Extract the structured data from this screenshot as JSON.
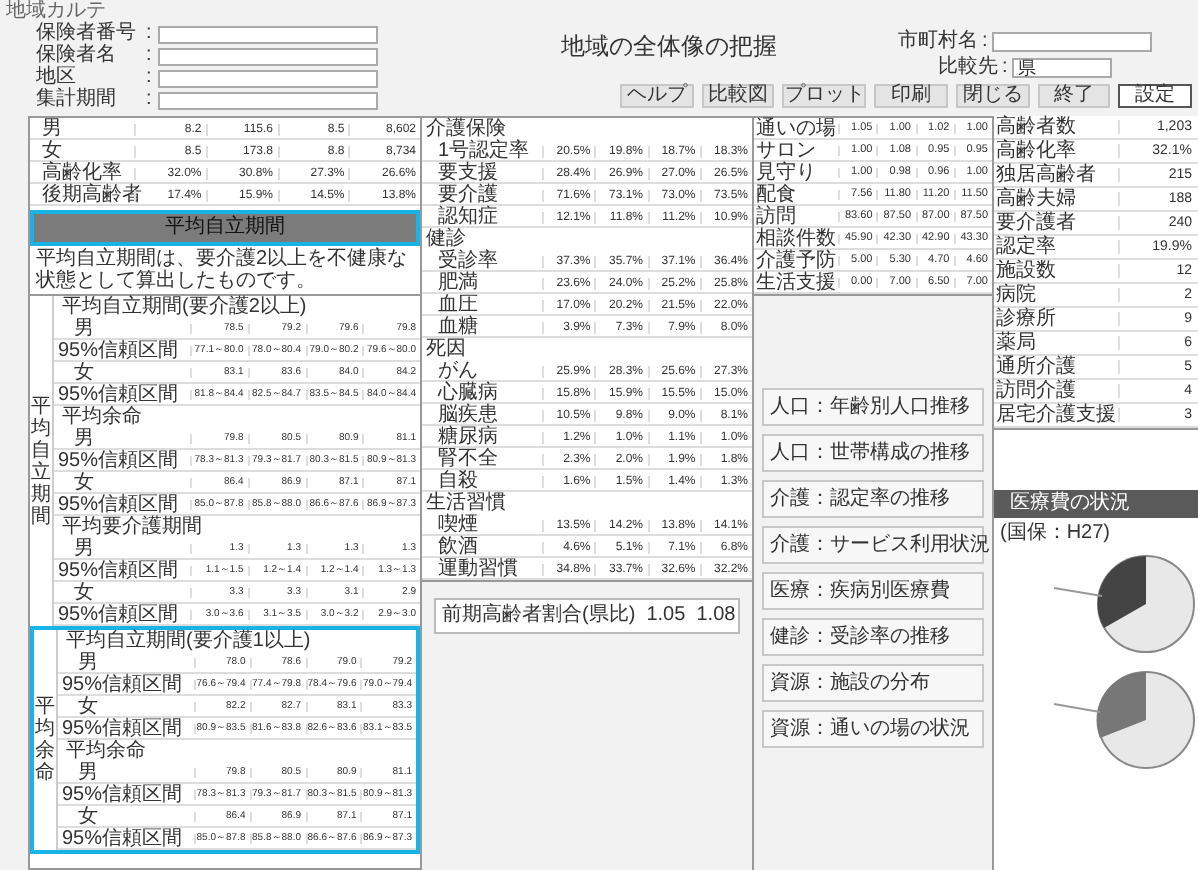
{
  "app_title": "地域カルテ",
  "filters": [
    {
      "label": "保険者番号",
      "separator": ":"
    },
    {
      "label": "保険者名",
      "separator": ":"
    },
    {
      "label": "地区",
      "separator": ":"
    },
    {
      "label": "集計期間",
      "separator": ":"
    }
  ],
  "title": "地域の全体像の把握",
  "compare": [
    {
      "label": "市町村名",
      "separator": ":"
    },
    {
      "label": "比較先",
      "separator": ":",
      "value": "県"
    }
  ],
  "buttons": [
    "ヘルプ",
    "比較図",
    "プロット",
    "印刷",
    "閉じる",
    "終了",
    "設定"
  ],
  "population_table": {
    "rows": [
      {
        "label": "男",
        "values": [
          "8.2",
          "115.6",
          "8.5",
          "8,602"
        ]
      },
      {
        "label": "女",
        "values": [
          "8.5",
          "173.8",
          "8.8",
          "8,734"
        ]
      },
      {
        "label": "高齢化率",
        "values": [
          "32.0%",
          "30.8%",
          "27.3%",
          "26.6%"
        ]
      },
      {
        "label": "後期高齢者",
        "values": [
          "17.4%",
          "15.9%",
          "14.5%",
          "13.8%"
        ]
      }
    ]
  },
  "section_bar": "平均自立期間",
  "note": "平均自立期間は、要介護2以上を不健康な状態として算出したものです。",
  "sections": [
    {
      "side_label": "平均自立期間",
      "groups": [
        {
          "title": "平均自立期間(要介護2以上)",
          "rows": [
            {
              "label": "男",
              "values": [
                "78.5",
                "79.2",
                "79.6",
                "79.8"
              ]
            },
            {
              "label": "95%信頼区間",
              "values": [
                "77.1～80.0",
                "78.0～80.4",
                "79.0～80.2",
                "79.6～80.0"
              ]
            },
            {
              "label": "女",
              "values": [
                "83.1",
                "83.6",
                "84.0",
                "84.2"
              ]
            },
            {
              "label": "95%信頼区間",
              "values": [
                "81.8～84.4",
                "82.5～84.7",
                "83.5～84.5",
                "84.0～84.4"
              ]
            }
          ]
        },
        {
          "title": "平均余命",
          "rows": [
            {
              "label": "男",
              "values": [
                "79.8",
                "80.5",
                "80.9",
                "81.1"
              ]
            },
            {
              "label": "95%信頼区間",
              "values": [
                "78.3～81.3",
                "79.3～81.7",
                "80.3～81.5",
                "80.9～81.3"
              ]
            },
            {
              "label": "女",
              "values": [
                "86.4",
                "86.9",
                "87.1",
                "87.1"
              ]
            },
            {
              "label": "95%信頼区間",
              "values": [
                "85.0～87.8",
                "85.8～88.0",
                "86.6～87.6",
                "86.9～87.3"
              ]
            }
          ]
        },
        {
          "title": "平均要介護期間",
          "rows": [
            {
              "label": "男",
              "values": [
                "1.3",
                "1.3",
                "1.3",
                "1.3"
              ]
            },
            {
              "label": "95%信頼区間",
              "values": [
                "1.1～1.5",
                "1.2～1.4",
                "1.2～1.4",
                "1.3～1.3"
              ]
            },
            {
              "label": "女",
              "values": [
                "3.3",
                "3.3",
                "3.1",
                "2.9"
              ]
            },
            {
              "label": "95%信頼区間",
              "values": [
                "3.0～3.6",
                "3.1～3.5",
                "3.0～3.2",
                "2.9～3.0"
              ]
            }
          ]
        }
      ]
    },
    {
      "side_label": "平均余命",
      "groups": [
        {
          "title": "平均自立期間(要介護1以上)",
          "rows": [
            {
              "label": "男",
              "values": [
                "78.0",
                "78.6",
                "79.0",
                "79.2"
              ]
            },
            {
              "label": "95%信頼区間",
              "values": [
                "76.6～79.4",
                "77.4～79.8",
                "78.4～79.6",
                "79.0～79.4"
              ]
            },
            {
              "label": "女",
              "values": [
                "82.2",
                "82.7",
                "83.1",
                "83.3"
              ]
            },
            {
              "label": "95%信頼区間",
              "values": [
                "80.9～83.5",
                "81.6～83.8",
                "82.6～83.6",
                "83.1～83.5"
              ]
            }
          ]
        },
        {
          "title": "平均余命",
          "rows": [
            {
              "label": "男",
              "values": [
                "79.8",
                "80.5",
                "80.9",
                "81.1"
              ]
            },
            {
              "label": "95%信頼区間",
              "values": [
                "78.3～81.3",
                "79.3～81.7",
                "80.3～81.5",
                "80.9～81.3"
              ]
            },
            {
              "label": "女",
              "values": [
                "86.4",
                "86.9",
                "87.1",
                "87.1"
              ]
            },
            {
              "label": "95%信頼区間",
              "values": [
                "85.0～87.8",
                "85.8～88.0",
                "86.6～87.6",
                "86.9～87.3"
              ]
            }
          ]
        }
      ]
    }
  ],
  "indicator_table": {
    "rows": [
      {
        "kind": "group",
        "label": "介護保険"
      },
      {
        "kind": "row",
        "label": "1号認定率",
        "values": [
          "20.5%",
          "19.8%",
          "18.7%",
          "18.3%"
        ]
      },
      {
        "kind": "row",
        "label": "要支援",
        "values": [
          "28.4%",
          "26.9%",
          "27.0%",
          "26.5%"
        ]
      },
      {
        "kind": "row",
        "label": "要介護",
        "values": [
          "71.6%",
          "73.1%",
          "73.0%",
          "73.5%"
        ]
      },
      {
        "kind": "row",
        "label": "認知症",
        "values": [
          "12.1%",
          "11.8%",
          "11.2%",
          "10.9%"
        ]
      },
      {
        "kind": "group",
        "label": "健診"
      },
      {
        "kind": "row",
        "label": "受診率",
        "values": [
          "37.3%",
          "35.7%",
          "37.1%",
          "36.4%"
        ]
      },
      {
        "kind": "row",
        "label": "肥満",
        "values": [
          "23.6%",
          "24.0%",
          "25.2%",
          "25.8%"
        ]
      },
      {
        "kind": "row",
        "label": "血圧",
        "values": [
          "17.0%",
          "20.2%",
          "21.5%",
          "22.0%"
        ]
      },
      {
        "kind": "row",
        "label": "血糖",
        "values": [
          "3.9%",
          "7.3%",
          "7.9%",
          "8.0%"
        ]
      },
      {
        "kind": "group",
        "label": "死因"
      },
      {
        "kind": "row",
        "label": "がん",
        "values": [
          "25.9%",
          "28.3%",
          "25.6%",
          "27.3%"
        ]
      },
      {
        "kind": "row",
        "label": "心臓病",
        "values": [
          "15.8%",
          "15.9%",
          "15.5%",
          "15.0%"
        ]
      },
      {
        "kind": "row",
        "label": "脳疾患",
        "values": [
          "10.5%",
          "9.8%",
          "9.0%",
          "8.1%"
        ]
      },
      {
        "kind": "row",
        "label": "糖尿病",
        "values": [
          "1.2%",
          "1.0%",
          "1.1%",
          "1.0%"
        ]
      },
      {
        "kind": "row",
        "label": "腎不全",
        "values": [
          "2.3%",
          "2.0%",
          "1.9%",
          "1.8%"
        ]
      },
      {
        "kind": "row",
        "label": "自殺",
        "values": [
          "1.6%",
          "1.5%",
          "1.4%",
          "1.3%"
        ]
      },
      {
        "kind": "group",
        "label": "生活習慣"
      },
      {
        "kind": "row",
        "label": "喫煙",
        "values": [
          "13.5%",
          "14.2%",
          "13.8%",
          "14.1%"
        ]
      },
      {
        "kind": "row",
        "label": "飲酒",
        "values": [
          "4.6%",
          "5.1%",
          "7.1%",
          "6.8%"
        ]
      },
      {
        "kind": "row",
        "label": "運動習慣",
        "values": [
          "34.8%",
          "33.7%",
          "32.6%",
          "32.2%"
        ]
      }
    ]
  },
  "ranking_note": "前期高齢者割合(県比)  1.05  1.08",
  "small_table": {
    "rows": [
      {
        "label": "通いの場",
        "values": [
          "1.05",
          "1.00",
          "1.02",
          "1.00"
        ]
      },
      {
        "label": "サロン",
        "values": [
          "1.00",
          "1.08",
          "0.95",
          "0.95"
        ]
      },
      {
        "label": "見守り",
        "values": [
          "1.00",
          "0.98",
          "0.96",
          "1.00"
        ]
      },
      {
        "label": "配食",
        "values": [
          "7.56",
          "11.80",
          "11.20",
          "11.50"
        ]
      },
      {
        "label": "訪問",
        "values": [
          "83.60",
          "87.50",
          "87.00",
          "87.50"
        ]
      },
      {
        "label": "相談件数",
        "values": [
          "45.90",
          "42.30",
          "42.90",
          "43.30"
        ]
      },
      {
        "label": "介護予防",
        "values": [
          "5.00",
          "5.30",
          "4.70",
          "4.60"
        ]
      },
      {
        "label": "生活支援",
        "values": [
          "0.00",
          "7.00",
          "6.50",
          "7.00"
        ]
      }
    ]
  },
  "topic_buttons": [
    "人口：年齢別人口推移",
    "人口：世帯構成の推移",
    "介護：認定率の推移",
    "介護：サービス利用状況",
    "医療：疾病別医療費",
    "健診：受診率の推移",
    "資源：施設の分布",
    "資源：通いの場の状況"
  ],
  "side_table": {
    "rows": [
      {
        "label": "高齢者数",
        "value": "1,203"
      },
      {
        "label": "高齢化率",
        "value": "32.1%"
      },
      {
        "label": "独居高齢者",
        "value": "215"
      },
      {
        "label": "高齢夫婦",
        "value": "188"
      },
      {
        "label": "要介護者",
        "value": "240"
      },
      {
        "label": "認定率",
        "value": "19.9%"
      },
      {
        "label": "施設数",
        "value": "12"
      },
      {
        "label": "病院",
        "value": "2"
      },
      {
        "label": "診療所",
        "value": "9"
      },
      {
        "label": "薬局",
        "value": "6"
      },
      {
        "label": "通所介護",
        "value": "5"
      },
      {
        "label": "訪問介護",
        "value": "4"
      },
      {
        "label": "居宅介護支援",
        "value": "3"
      }
    ]
  },
  "chart_header": "医療費の状況",
  "chart_caption": "(国保：H27)"
}
